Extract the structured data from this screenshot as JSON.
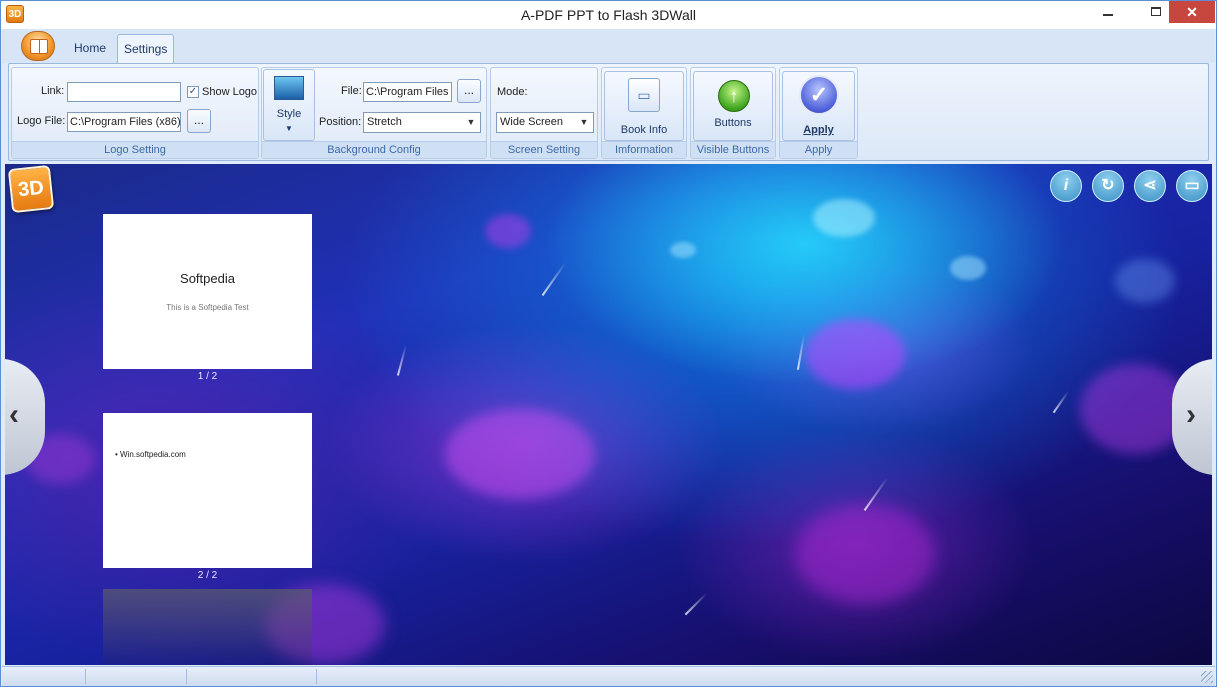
{
  "window": {
    "title": "A-PDF PPT to Flash 3DWall",
    "app_icon_text": "3D",
    "close_glyph": "✕"
  },
  "tabs": [
    {
      "label": "Home",
      "active": false
    },
    {
      "label": "Settings",
      "active": true
    }
  ],
  "logo_setting": {
    "link_label": "Link:",
    "link_value": "",
    "show_logo_label": "Show Logo",
    "show_logo_checked": true,
    "logo_file_label": "Logo File:",
    "logo_file_value": "C:\\Program Files (x86)\\",
    "browse_label": "...",
    "group_label": "Logo Setting"
  },
  "background_config": {
    "style_label": "Style",
    "file_label": "File:",
    "file_value": "C:\\Program Files (",
    "browse_label": "...",
    "position_label": "Position:",
    "position_value": "Stretch",
    "group_label": "Background Config"
  },
  "screen_setting": {
    "mode_label": "Mode:",
    "mode_value": "Wide Screen",
    "group_label": "Screen Setting"
  },
  "information": {
    "button_label": "Book Info",
    "group_label": "Imformation"
  },
  "visible_buttons": {
    "button_label": "Buttons",
    "group_label": "Visible Buttons"
  },
  "apply": {
    "button_label": "Apply",
    "group_label": "Apply"
  },
  "viewer": {
    "logo_text": "3D",
    "top_icons": [
      "info-icon",
      "refresh-icon",
      "share-icon",
      "fullscreen-icon"
    ],
    "slides": [
      {
        "title": "Softpedia",
        "subtitle": "This is a Softpedia Test",
        "page": "1 / 2"
      },
      {
        "bullet": "Win.softpedia.com",
        "page": "2 / 2"
      }
    ],
    "prev_glyph": "‹",
    "next_glyph": "›"
  },
  "colors": {
    "accent": "#3e6aa6",
    "close_button": "#c7463d",
    "logo_orange": "#e57a10"
  }
}
